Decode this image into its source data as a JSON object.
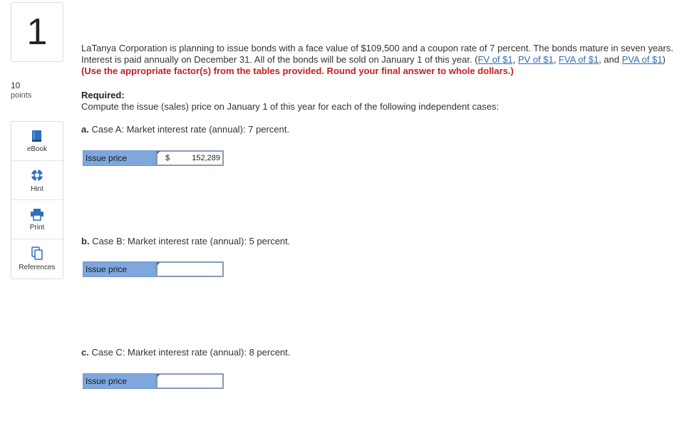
{
  "question": {
    "number": "1",
    "points_value": "10",
    "points_label": "points"
  },
  "tools": [
    {
      "label": "eBook",
      "icon": "ebook-icon"
    },
    {
      "label": "Hint",
      "icon": "hint-icon"
    },
    {
      "label": "Print",
      "icon": "print-icon"
    },
    {
      "label": "References",
      "icon": "references-icon"
    }
  ],
  "problem": {
    "intro": "LaTanya Corporation is planning to issue bonds with a face value of $109,500 and a coupon rate of 7 percent. The bonds mature in seven years. Interest is paid annually on December 31. All of the bonds will be sold on January 1 of this year. (",
    "links": [
      "FV of $1",
      "PV of $1",
      "FVA of $1",
      "PVA of $1"
    ],
    "sep1": ", ",
    "sep2": ", ",
    "sep3": ", and ",
    "close_paren": ") ",
    "instruction": "(Use the appropriate factor(s) from the tables provided. Round your final answer to whole dollars.)"
  },
  "required": {
    "heading": "Required:",
    "text": "Compute the issue (sales) price on January 1 of this year for each of the following independent cases:"
  },
  "cases": [
    {
      "letter": "a.",
      "text": "Case A: Market interest rate (annual): 7 percent.",
      "answer_label": "Issue price",
      "currency": "$",
      "value": "152,289"
    },
    {
      "letter": "b.",
      "text": "Case B: Market interest rate (annual): 5 percent.",
      "answer_label": "Issue price",
      "currency": "",
      "value": ""
    },
    {
      "letter": "c.",
      "text": "Case C: Market interest rate (annual): 8 percent.",
      "answer_label": "Issue price",
      "currency": "",
      "value": ""
    }
  ],
  "colors": {
    "answer_label_bg": "#7fa7dd",
    "link": "#2a6ebb",
    "warning": "#c42121"
  }
}
